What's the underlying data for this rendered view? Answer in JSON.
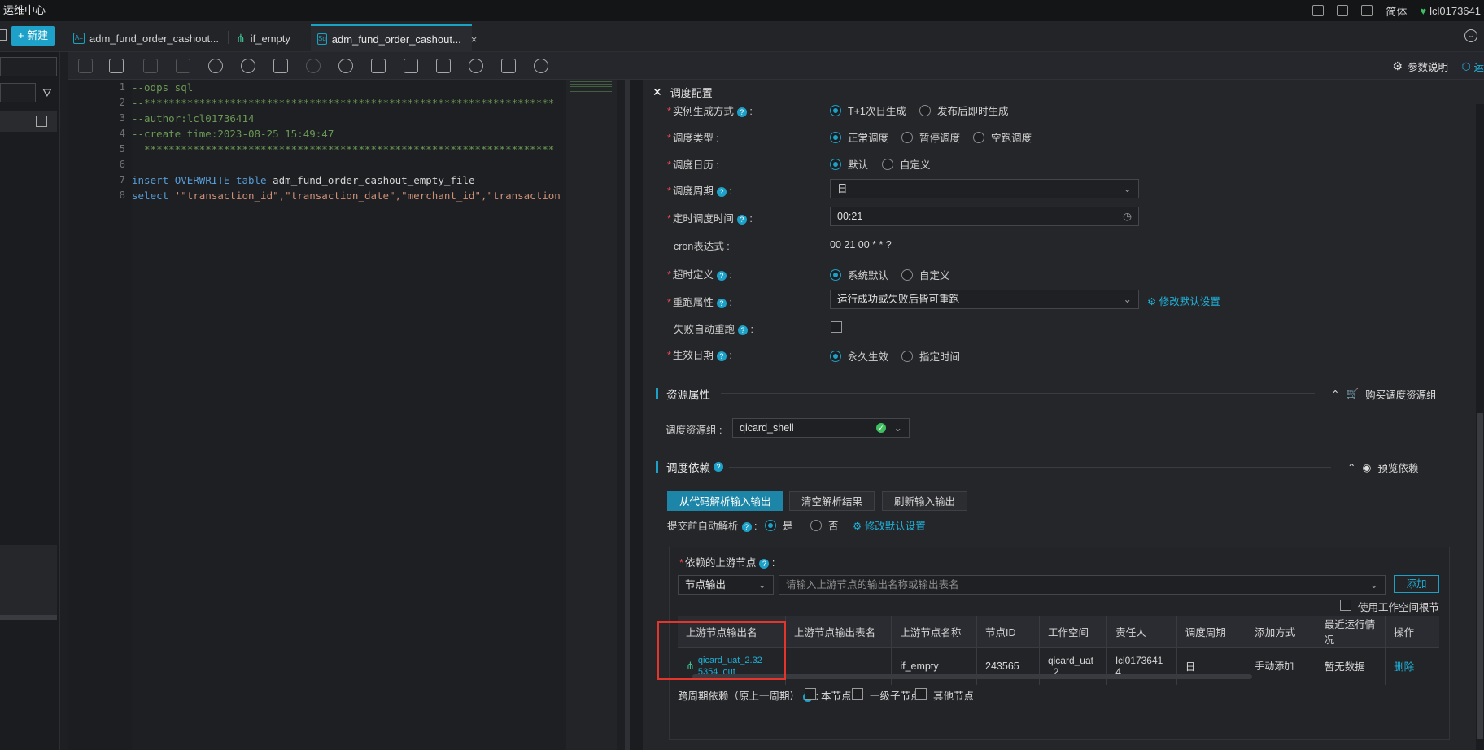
{
  "app": {
    "title": "运维中心",
    "lang": "简体",
    "user": "lcl0173641"
  },
  "toolbar_left": {
    "new_button": "+ 新建"
  },
  "tabs": [
    {
      "label": "adm_fund_order_cashout...",
      "icon": "A="
    },
    {
      "label": "if_empty",
      "icon": "flow-icon"
    },
    {
      "label": "adm_fund_order_cashout...",
      "icon": "Sq",
      "close": "×"
    }
  ],
  "toolbar_right": {
    "param_desc": "参数说明",
    "ops": "运"
  },
  "editor": {
    "lines": [
      "1",
      "2",
      "3",
      "4",
      "5",
      "6",
      "7",
      "8"
    ],
    "code": {
      "l1": "--odps sql",
      "l2": "--*******************************************************************",
      "l3": "--author:lcl01736414",
      "l4": "--create time:2023-08-25 15:49:47",
      "l5": "--*******************************************************************",
      "l7_kw1": "insert",
      "l7_kw2": "OVERWRITE",
      "l7_kw3": "table",
      "l7_rest": "adm_fund_order_cashout_empty_file",
      "l8_kw": "select",
      "l8_str": "'\"transaction_id\",\"transaction_date\",\"merchant_id\",\"transaction"
    }
  },
  "panel": {
    "title": "调度配置",
    "close": "✕",
    "fields": {
      "instance_gen": {
        "label": "实例生成方式",
        "opt1": "T+1次日生成",
        "opt2": "发布后即时生成"
      },
      "sched_type": {
        "label": "调度类型",
        "opt1": "正常调度",
        "opt2": "暂停调度",
        "opt3": "空跑调度"
      },
      "calendar": {
        "label": "调度日历",
        "opt1": "默认",
        "opt2": "自定义"
      },
      "period": {
        "label": "调度周期",
        "value": "日"
      },
      "time": {
        "label": "定时调度时间",
        "value": "00:21"
      },
      "cron": {
        "label": "cron表达式",
        "value": "00 21 00 * * ?"
      },
      "timeout": {
        "label": "超时定义",
        "opt1": "系统默认",
        "opt2": "自定义"
      },
      "rerun": {
        "label": "重跑属性",
        "value": "运行成功或失败后皆可重跑",
        "link": "修改默认设置"
      },
      "auto_rerun": {
        "label": "失败自动重跑"
      },
      "effective": {
        "label": "生效日期",
        "opt1": "永久生效",
        "opt2": "指定时间"
      }
    },
    "resource": {
      "title": "资源属性",
      "buy": "购买调度资源组",
      "group_label": "调度资源组",
      "group_value": "qicard_shell"
    },
    "deps": {
      "title": "调度依赖",
      "preview": "预览依赖",
      "btn_parse": "从代码解析输入输出",
      "btn_clear": "清空解析结果",
      "btn_refresh": "刷新输入输出",
      "auto_parse_label": "提交前自动解析",
      "yes": "是",
      "no": "否",
      "modify": "修改默认设置",
      "upstream_label": "依赖的上游节点",
      "node_output": "节点输出",
      "search_placeholder": "请输入上游节点的输出名称或输出表名",
      "add": "添加",
      "use_root": "使用工作空间根节点",
      "columns": [
        "上游节点输出名",
        "上游节点输出表名",
        "上游节点名称",
        "节点ID",
        "工作空间",
        "责任人",
        "调度周期",
        "添加方式",
        "最近运行情况",
        "操作"
      ],
      "row": {
        "output_name": "qicard_uat_2.325354_out",
        "output_table": "",
        "node_name": "if_empty",
        "node_id": "243565",
        "workspace": "qicard_uat_2",
        "owner": "lcl01736414",
        "period": "日",
        "add_method": "手动添加",
        "last_run": "暂无数据",
        "action": "删除"
      },
      "cross_label": "跨周期依赖（原上一周期）",
      "cross_opt1": "本节点",
      "cross_opt2": "一级子节点",
      "cross_opt3": "其他节点"
    }
  },
  "colors": {
    "accent": "#1da1c8",
    "required": "#e5484d",
    "highlight_box": "#e3352c"
  }
}
